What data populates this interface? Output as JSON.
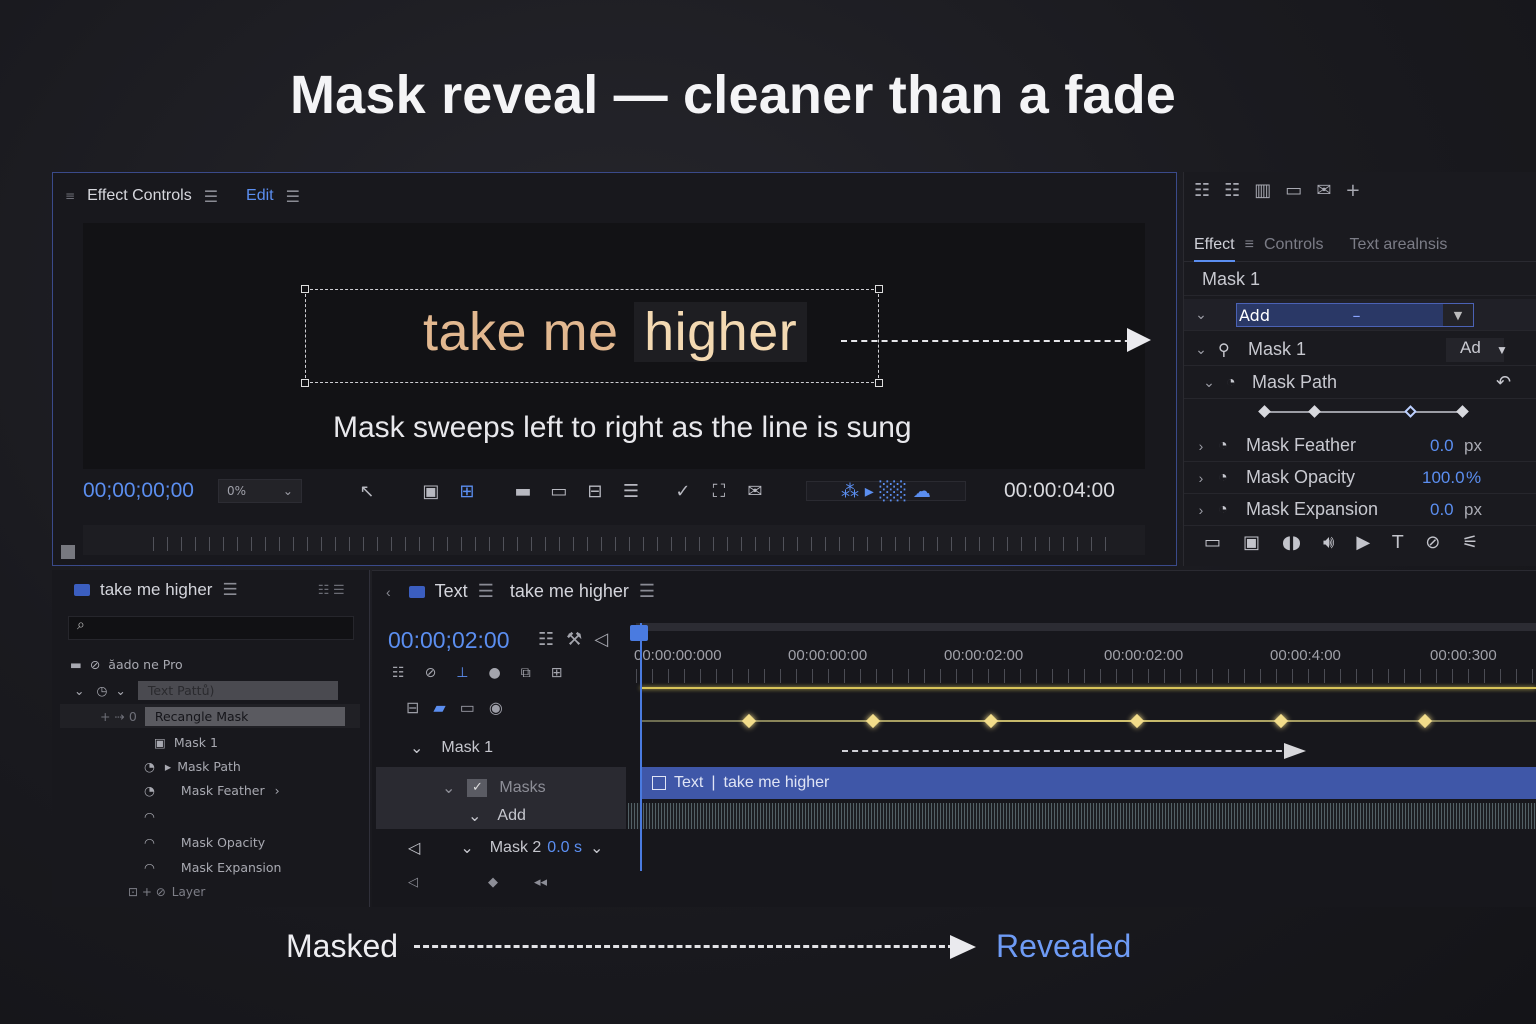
{
  "headline": "Mask reveal — cleaner than a fade",
  "effect_controls": {
    "tab_label": "Effect Controls",
    "edit_label": "Edit",
    "lyric_text_plain": "take me",
    "lyric_text_highlight": "higher",
    "caption": "Mask sweeps left to right as the line is sung",
    "current_timecode": "00;00;00;00",
    "zoom_value": "0%",
    "end_timecode": "00:00:04:00"
  },
  "right_panel": {
    "tabs": [
      "Effect",
      "Controls",
      "Text arealnsis"
    ],
    "mask_header": "Mask 1",
    "mode_dropdown": "Add",
    "mask_row_label": "Mask 1",
    "mask_row_mode": "Ad",
    "mask_path_label": "Mask Path",
    "properties": [
      {
        "label": "Mask Feather",
        "value": "0.0",
        "unit": "px"
      },
      {
        "label": "Mask Opacity",
        "value": "100.0",
        "unit": "%"
      },
      {
        "label": "Mask Expansion",
        "value": "0.0",
        "unit": "px"
      }
    ]
  },
  "project": {
    "title": "take me higher",
    "search_placeholder": "",
    "rows": [
      {
        "label": "ăado ne Pro"
      },
      {
        "label": "Text Pattů)"
      },
      {
        "label": "Recangle Mask"
      },
      {
        "label": "Mask 1"
      },
      {
        "label": "Mask Path"
      },
      {
        "label": "Mask Feather"
      },
      {
        "label": ""
      },
      {
        "label": "Mask Opacity"
      },
      {
        "label": "Mask Expansion"
      },
      {
        "label": "Layer"
      }
    ]
  },
  "timeline": {
    "tab_text": "Text",
    "sequence_name": "take me higher",
    "timecode": "00:00;02:00",
    "ruler_labels": [
      "00:00:00:000",
      "00:00:00:00",
      "00:00:02:00",
      "00:00:02:00",
      "00:00:4:00",
      "00:00:300"
    ],
    "rows": {
      "mask1": "Mask 1",
      "masks": "Masks",
      "add": "Add",
      "mask2": "Mask 2",
      "mask2_value": "0.0 s"
    },
    "clip_label_a": "Text",
    "clip_label_b": "take me higher"
  },
  "bottom": {
    "masked": "Masked",
    "revealed": "Revealed"
  },
  "colors": {
    "accent": "#5b8ef0",
    "clip": "#3f57a8",
    "keyframe": "#f2dc8a",
    "lyric": "#e2b890"
  }
}
